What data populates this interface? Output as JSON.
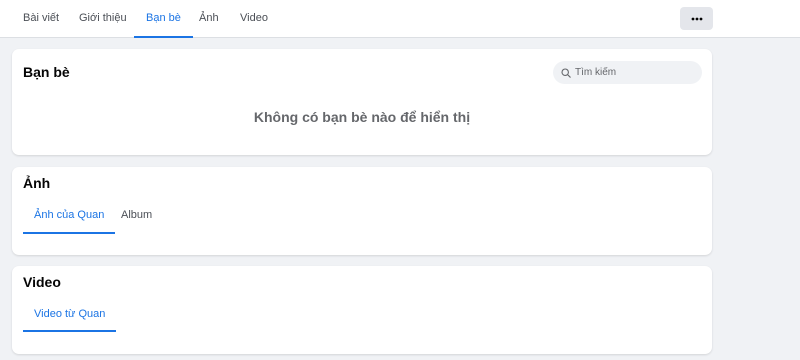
{
  "nav": {
    "tabs": [
      {
        "label": "Bài viết",
        "active": false
      },
      {
        "label": "Giới thiệu",
        "active": false
      },
      {
        "label": "Bạn bè",
        "active": true
      },
      {
        "label": "Ảnh",
        "active": false
      },
      {
        "label": "Video",
        "active": false
      }
    ],
    "more_icon": "more-horizontal-icon"
  },
  "friends": {
    "title": "Bạn bè",
    "search_placeholder": "Tìm kiếm",
    "search_icon": "search-icon",
    "empty_message": "Không có bạn bè nào để hiển thị"
  },
  "photos": {
    "title": "Ảnh",
    "tabs": [
      {
        "label": "Ảnh của Quan",
        "active": true
      },
      {
        "label": "Album",
        "active": false
      }
    ]
  },
  "videos": {
    "title": "Video",
    "tabs": [
      {
        "label": "Video từ Quan",
        "active": true
      }
    ]
  },
  "colors": {
    "accent": "#1b74e4",
    "background": "#f0f2f5",
    "card": "#ffffff",
    "muted_text": "#65676b"
  }
}
